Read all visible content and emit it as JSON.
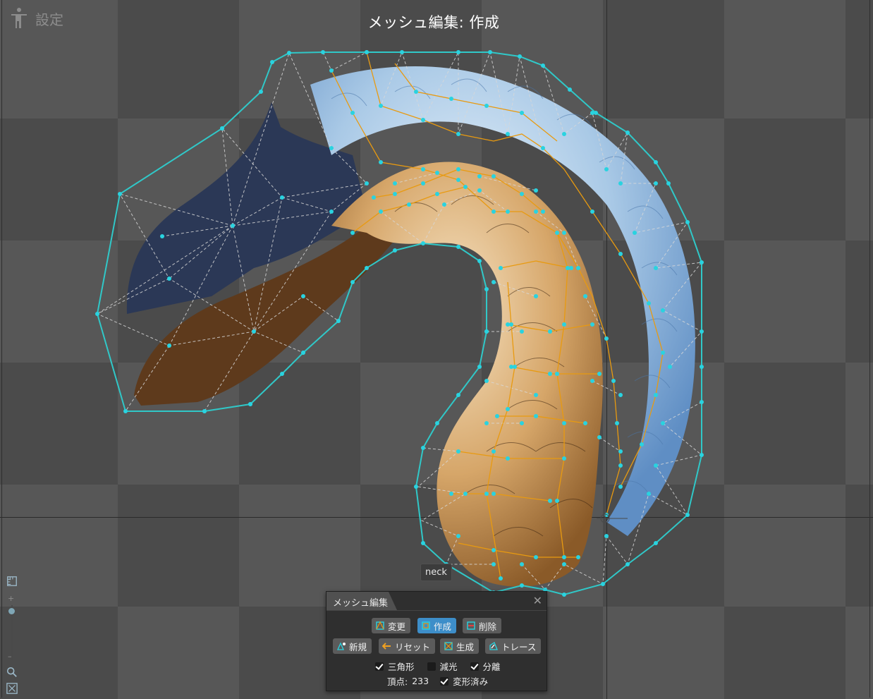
{
  "header": {
    "settings_label": "設定",
    "mode_title": "メッシュ編集: 作成"
  },
  "canvas": {
    "bone_label": "neck"
  },
  "panel": {
    "title": "メッシュ編集",
    "buttons_row1": [
      {
        "label": "変更",
        "active": false
      },
      {
        "label": "作成",
        "active": true
      },
      {
        "label": "削除",
        "active": false
      }
    ],
    "buttons_row2": [
      {
        "label": "新規"
      },
      {
        "label": "リセット"
      },
      {
        "label": "生成"
      },
      {
        "label": "トレース"
      }
    ],
    "options": [
      {
        "label": "三角形",
        "checked": true
      },
      {
        "label": "減光",
        "checked": false
      },
      {
        "label": "分離",
        "checked": true
      }
    ],
    "vertex_label": "頂点:",
    "vertex_count": "233",
    "deformed_label": "変形済み",
    "deformed_checked": true
  },
  "colors": {
    "hull": "#30c8c8",
    "vertex": "#29d3e0",
    "edge": "#e89a10",
    "active_button": "#3d8ec9"
  }
}
